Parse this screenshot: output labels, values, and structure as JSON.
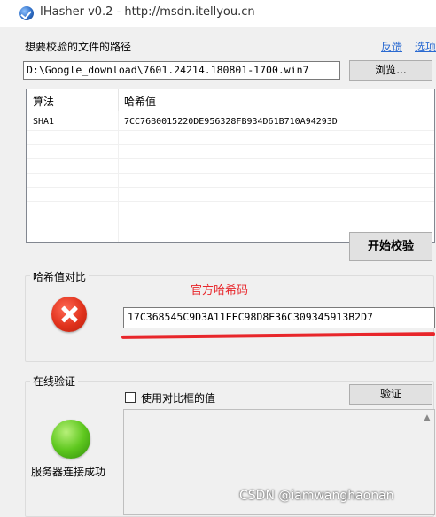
{
  "window": {
    "title": "IHasher v0.2 - http://msdn.itellyou.cn"
  },
  "top": {
    "path_label": "想要校验的文件的路径",
    "feedback_link": "反馈",
    "options_link": "选项",
    "path_value": "D:\\Google_download\\7601.24214.180801-1700.win7",
    "browse_button": "浏览..."
  },
  "hash_table": {
    "columns": [
      "算法",
      "哈希值"
    ],
    "rows": [
      {
        "algorithm": "SHA1",
        "hash": "7CC76B0015220DE956328FB934D61B710A94293D"
      }
    ]
  },
  "start_button": "开始校验",
  "compare": {
    "group_title": "哈希值对比",
    "status_icon": "error-icon",
    "hash_value": "17C368545C9D3A11EEC98D8E36C309345913B2D7",
    "annotation": "官方哈希码",
    "annotation_color": "#e8262b"
  },
  "online": {
    "group_title": "在线验证",
    "checkbox_label": "使用对比框的值",
    "checkbox_checked": false,
    "verify_button": "验证",
    "status_icon": "green-status-icon",
    "status_text": "服务器连接成功"
  },
  "watermark": "CSDN @iamwanghaonan"
}
